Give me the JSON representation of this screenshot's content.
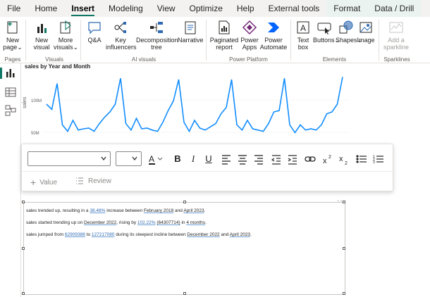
{
  "tabs": [
    {
      "label": "File"
    },
    {
      "label": "Home"
    },
    {
      "label": "Insert"
    },
    {
      "label": "Modeling"
    },
    {
      "label": "View"
    },
    {
      "label": "Optimize"
    },
    {
      "label": "Help"
    },
    {
      "label": "External tools"
    },
    {
      "label": "Format"
    },
    {
      "label": "Data / Drill"
    }
  ],
  "ribbon": {
    "new_page_line1": "New",
    "new_page_line2": "page",
    "new_visual_line1": "New",
    "new_visual_line2": "visual",
    "more_visuals_line1": "More",
    "more_visuals_line2": "visuals",
    "qa": "Q&A",
    "key_influencers_line1": "Key",
    "key_influencers_line2": "influencers",
    "decomposition_line1": "Decomposition",
    "decomposition_line2": "tree",
    "narrative": "Narrative",
    "paginated_line1": "Paginated",
    "paginated_line2": "report",
    "power_apps_line1": "Power",
    "power_apps_line2": "Apps",
    "power_automate_line1": "Power",
    "power_automate_line2": "Automate",
    "text_box_line1": "Text",
    "text_box_line2": "box",
    "buttons": "Buttons",
    "shapes": "Shapes",
    "image": "Image",
    "sparkline_line1": "Add a",
    "sparkline_line2": "sparkline",
    "groups": {
      "pages": "Pages",
      "visuals": "Visuals",
      "ai_visuals": "AI visuals",
      "power_platform": "Power Platform",
      "elements": "Elements",
      "sparklines": "Sparklines"
    },
    "accent": "#117865"
  },
  "chart": {
    "title": "sales by Year and Month",
    "ylabel": "sales",
    "ytick_high": "100M",
    "ytick_low": "50M"
  },
  "chart_data": {
    "type": "line",
    "title": "sales by Year and Month",
    "ylabel": "sales",
    "yticks": [
      "50M",
      "100M"
    ],
    "ylim": [
      40000000,
      140000000
    ],
    "series": [
      {
        "color": "#118dff",
        "values": [
          90000000,
          82000000,
          122000000,
          58000000,
          48000000,
          65000000,
          50000000,
          52000000,
          53000000,
          48000000,
          60000000,
          70000000,
          78000000,
          90000000,
          130000000,
          60000000,
          50000000,
          68000000,
          52000000,
          53000000,
          50000000,
          48000000,
          62000000,
          80000000,
          95000000,
          128000000,
          62000000,
          48000000,
          65000000,
          53000000,
          50000000,
          55000000,
          60000000,
          75000000,
          85000000,
          128000000,
          58000000,
          50000000,
          65000000,
          52000000,
          50000000,
          48000000,
          60000000,
          78000000,
          80000000,
          130000000,
          58000000,
          46000000,
          58000000,
          50000000,
          52000000,
          50000000,
          58000000,
          75000000,
          78000000,
          90000000,
          132000000
        ]
      }
    ]
  },
  "toolbar": {
    "font_family_value": "",
    "font_size_value": "",
    "bold": "B",
    "italic": "I",
    "underline": "U",
    "value_label": "Value",
    "review_label": "Review"
  },
  "narrative": {
    "line1": {
      "a": "sales trended up, resulting in a ",
      "b": "38.48%",
      "c": " increase between ",
      "d": "February 2018",
      "e": " and ",
      "f": "April 2023",
      "g": "."
    },
    "line2": {
      "a": "sales started trending up on ",
      "b": "December 2022",
      "c": ", rising by ",
      "d": "102.22%",
      "e": " ",
      "f": "(64307714)",
      "g": " in ",
      "h": "4 months",
      "i": "."
    },
    "line3": {
      "a": "sales jumped from ",
      "b": "62909386",
      "c": " to ",
      "d": "127217080",
      "e": " during its steepest incline between ",
      "f": "December 2022",
      "g": " and ",
      "h": "April 2023",
      "i": "."
    },
    "more_options": "···"
  }
}
